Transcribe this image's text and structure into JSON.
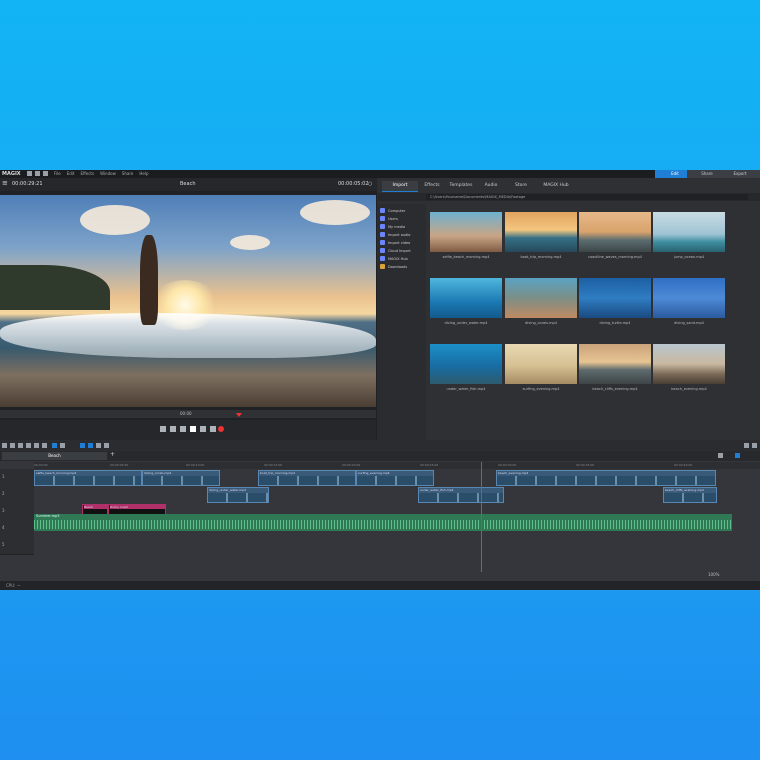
{
  "app": {
    "logo": "MAGIX",
    "menu": [
      "File",
      "Edit",
      "Effects",
      "Window",
      "Share",
      "Help"
    ],
    "modes": [
      "Edit",
      "Share",
      "Export"
    ]
  },
  "preview": {
    "timecode_left": "00:00:29:21",
    "title": "Beach",
    "timecode_right": "00:00:05:02",
    "scrub_time": "00:00"
  },
  "pool": {
    "tabs": [
      "Import",
      "Effects",
      "Templates",
      "Audio",
      "Store",
      "MAGIX Hub"
    ],
    "path": "C:\\Users\\Yourname\\Documents\\MAGIX_MEDIA\\Footage",
    "sidebar": [
      "Computer",
      "Users",
      "My media",
      "Import audio",
      "Import video",
      "Cloud Import",
      "MAGIX Hub",
      "Downloads"
    ],
    "media": [
      "selfie_beach_morning.mp4",
      "boat_trip_morning.mp4",
      "coastline_waves_morning.mp4",
      "jump_ocean.mp4",
      "diving_under_water.mp4",
      "diving_corals.mp4",
      "diving_turtle.mp4",
      "diving_sand.mp4",
      "under_water_fish.mp4",
      "surfing_evening.mp4",
      "beach_cliffs_evening.mp4",
      "beach_evening.mp4"
    ]
  },
  "timeline": {
    "tab": "Beach",
    "tracks": [
      "1",
      "2",
      "3",
      "4",
      "5"
    ],
    "ruler": [
      "00:00:00",
      "00:00:05:00",
      "00:00:10:00",
      "00:00:15:00",
      "00:00:20:00",
      "00:00:25:00",
      "00:00:30:00",
      "00:00:35:00",
      "00:00:40:00"
    ],
    "clip_labels": [
      "selfie_beach_morning.mp4",
      "diving_corals.mp4",
      "boat_trip_morning.mp4",
      "surfing_evening.mp4",
      "beach_evening.mp4",
      "diving_under_water.mp4",
      "under_water_fish.mp4",
      "beach_cliffs_evening.mp4",
      "Beach",
      "Rocky coast"
    ],
    "audio_label": "Summer.mp3",
    "zoom": "100%"
  },
  "status": {
    "left": "CPU: —"
  },
  "colors": {
    "accent": "#1f7fd6",
    "playhead": "#e33333",
    "audio": "#2f7a55",
    "title_clip": "#b0306a"
  }
}
